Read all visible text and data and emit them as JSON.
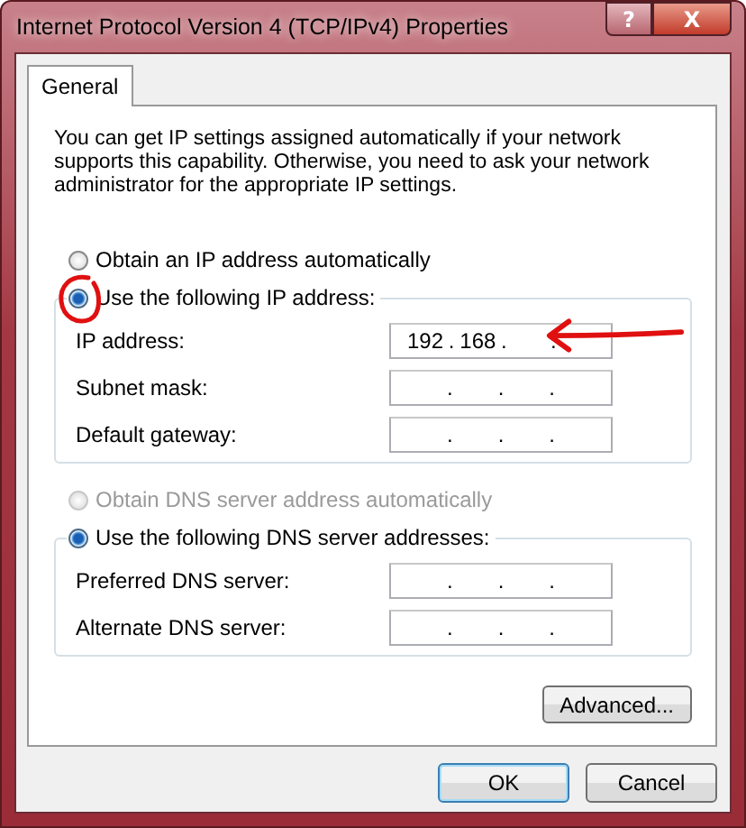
{
  "window": {
    "title": "Internet Protocol Version 4 (TCP/IPv4) Properties",
    "help_glyph": "?",
    "close_glyph": "X"
  },
  "tabs": [
    {
      "label": "General",
      "selected": true
    }
  ],
  "intro": "You can get IP settings assigned automatically if your network supports this capability. Otherwise, you need to ask your network administrator for the appropriate IP settings.",
  "ip_separator": ".",
  "ip_section": {
    "auto": {
      "label": "Obtain an IP address automatically",
      "selected": false,
      "disabled": false
    },
    "manual": {
      "label": "Use the following IP address:",
      "selected": true
    },
    "fields": [
      {
        "label": "IP address:",
        "octets": [
          "192",
          "168"
        ]
      },
      {
        "label": "Subnet mask:"
      },
      {
        "label": "Default gateway:"
      }
    ]
  },
  "dns_section": {
    "auto": {
      "label": "Obtain DNS server address automatically",
      "selected": false,
      "disabled": true
    },
    "manual": {
      "label": "Use the following DNS server addresses:",
      "selected": true
    },
    "fields": [
      {
        "label": "Preferred DNS server:"
      },
      {
        "label": "Alternate DNS server:"
      }
    ]
  },
  "advanced_button": "Advanced...",
  "buttons": [
    {
      "label": "OK",
      "default": true
    },
    {
      "label": "Cancel",
      "default": false
    }
  ]
}
